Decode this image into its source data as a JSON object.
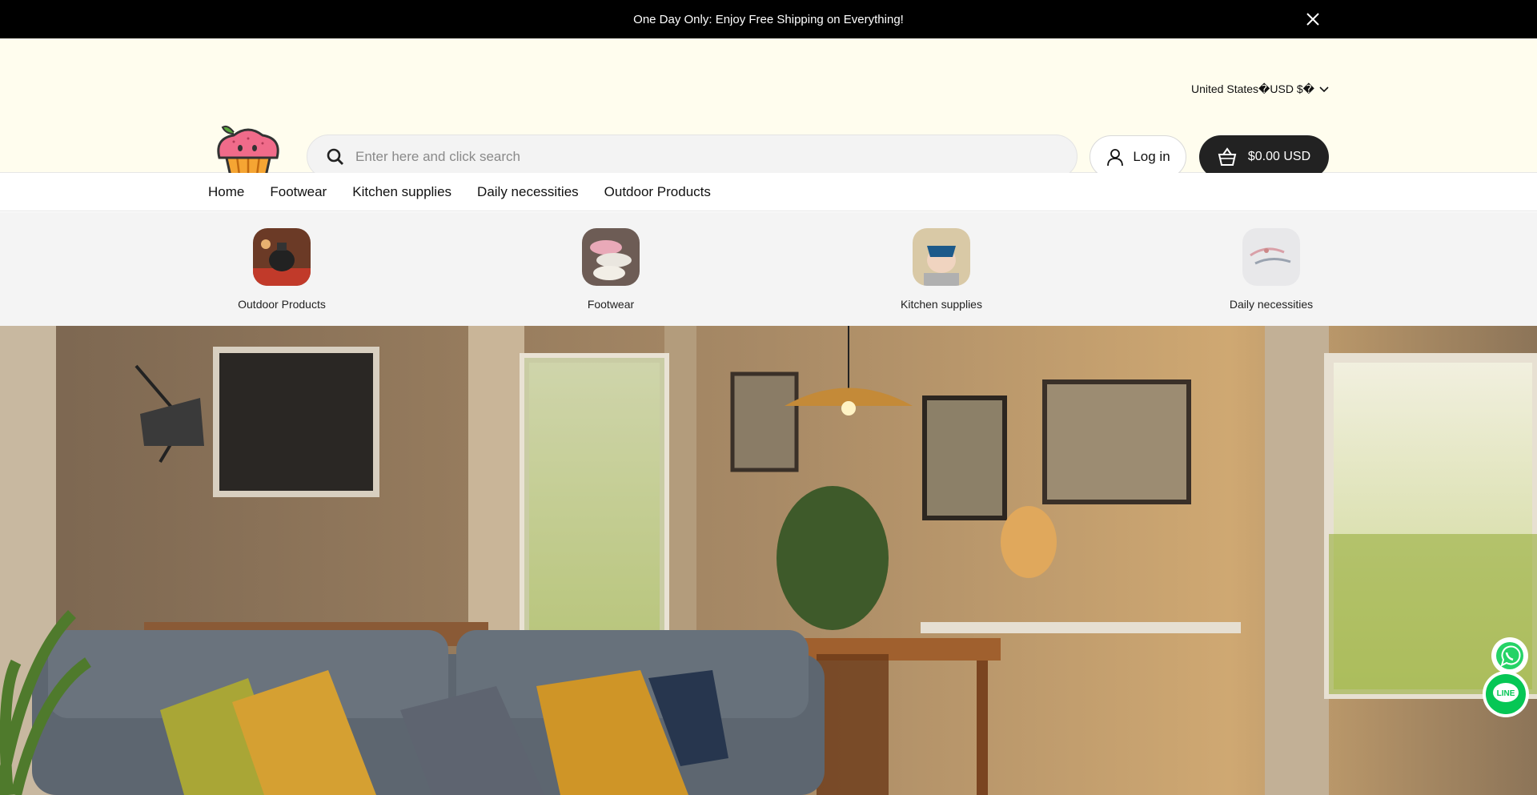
{
  "announcement": {
    "text": "One Day Only: Enjoy Free Shipping on Everything!"
  },
  "locale": {
    "label": "United States�USD $�"
  },
  "search": {
    "placeholder": "Enter here and click search"
  },
  "account": {
    "login_label": "Log in"
  },
  "cart": {
    "total": "$0.00 USD"
  },
  "nav": {
    "items": [
      {
        "label": "Home"
      },
      {
        "label": "Footwear"
      },
      {
        "label": "Kitchen supplies"
      },
      {
        "label": "Daily necessities"
      },
      {
        "label": "Outdoor Products"
      }
    ]
  },
  "categories": [
    {
      "label": "Outdoor Products"
    },
    {
      "label": "Footwear"
    },
    {
      "label": "Kitchen supplies"
    },
    {
      "label": "Daily necessities"
    }
  ],
  "floating": {
    "line_label": "LINE"
  },
  "colors": {
    "topbar": "#000000",
    "header_bg": "#fffdee",
    "cart_bg": "#222222",
    "whatsapp": "#25d366",
    "line": "#06c755"
  }
}
